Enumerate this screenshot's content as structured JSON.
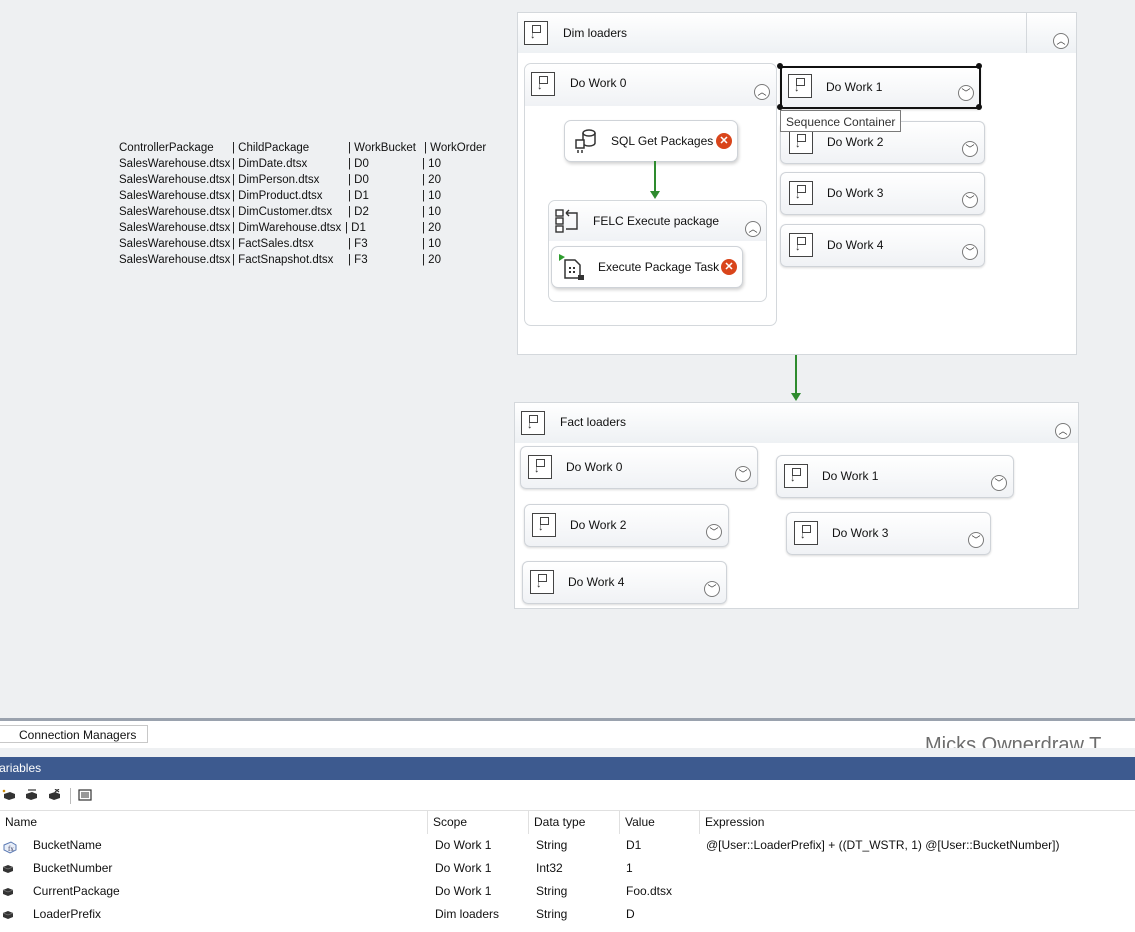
{
  "annotation": {
    "headers": [
      "ControllerPackage",
      "| ChildPackage",
      "| WorkBucket",
      "| WorkOrder"
    ],
    "rows": [
      [
        "SalesWarehouse.dtsx",
        "| DimDate.dtsx",
        "| D0",
        "| 10"
      ],
      [
        "SalesWarehouse.dtsx",
        "| DimPerson.dtsx",
        "| D0",
        "| 20"
      ],
      [
        "SalesWarehouse.dtsx",
        "| DimProduct.dtsx",
        "| D1",
        "| 10"
      ],
      [
        "SalesWarehouse.dtsx",
        "| DimCustomer.dtsx",
        "| D2",
        "| 10"
      ],
      [
        "SalesWarehouse.dtsx",
        "| DimWarehouse.dtsx",
        "| D1",
        "| 20"
      ],
      [
        "SalesWarehouse.dtsx",
        "| FactSales.dtsx",
        "| F3",
        "| 10"
      ],
      [
        "SalesWarehouse.dtsx",
        "| FactSnapshot.dtsx",
        "| F3",
        "| 20"
      ]
    ]
  },
  "dim_loaders": {
    "title": "Dim loaders",
    "do_work_0": {
      "title": "Do Work 0",
      "sql_task": "SQL Get Packages",
      "felc": "FELC Execute package",
      "exec_task": "Execute Package Task"
    },
    "do_work_1": "Do Work 1",
    "do_work_2": "Do Work 2",
    "do_work_3": "Do Work 3",
    "do_work_4": "Do Work 4",
    "tooltip": "Sequence Container"
  },
  "fact_loaders": {
    "title": "Fact loaders",
    "do_work_0": "Do Work 0",
    "do_work_1": "Do Work 1",
    "do_work_2": "Do Work 2",
    "do_work_3": "Do Work 3",
    "do_work_4": "Do Work 4"
  },
  "tabs": {
    "connection_managers": "Connection Managers"
  },
  "watermark": "Micks Ownerdraw T",
  "variables": {
    "title": "Variables",
    "columns": [
      "Name",
      "Scope",
      "Data type",
      "Value",
      "Expression"
    ],
    "rows": [
      {
        "name": "BucketName",
        "scope": "Do Work 1",
        "type": "String",
        "value": "D1",
        "expression": "@[User::LoaderPrefix] + ((DT_WSTR, 1)  @[User::BucketNumber])",
        "icon": "expression-variable-icon"
      },
      {
        "name": "BucketNumber",
        "scope": "Do Work 1",
        "type": "Int32",
        "value": "1",
        "expression": "",
        "icon": "variable-icon"
      },
      {
        "name": "CurrentPackage",
        "scope": "Do Work 1",
        "type": "String",
        "value": "Foo.dtsx",
        "expression": "",
        "icon": "variable-icon"
      },
      {
        "name": "LoaderPrefix",
        "scope": "Dim loaders",
        "type": "String",
        "value": "D",
        "expression": "",
        "icon": "variable-icon"
      }
    ]
  },
  "colors": {
    "precedence_arrow": "#2e8b2e",
    "error": "#d9451b",
    "variables_header": "#3d5a8f"
  }
}
